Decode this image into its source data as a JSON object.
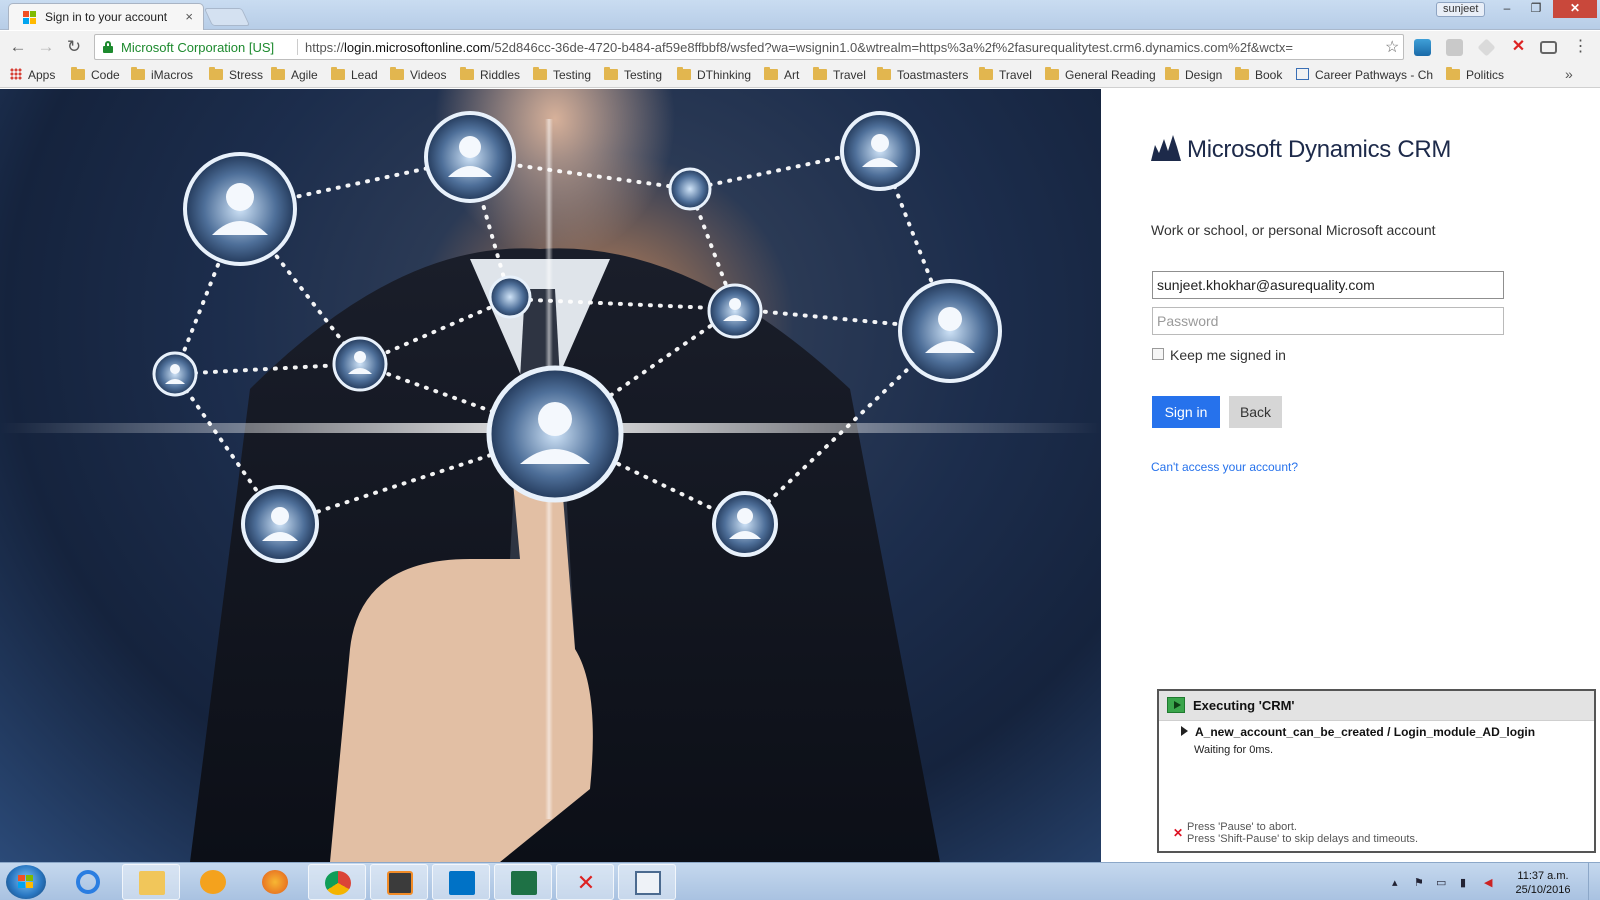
{
  "browser": {
    "tab_title": "Sign in to your account",
    "tab_close": "×",
    "profile_name": "sunjeet",
    "window_controls": {
      "minimize": "‒",
      "maximize": "❐",
      "close": "✕"
    },
    "nav": {
      "back": "←",
      "forward": "→",
      "reload": "↻"
    },
    "security_label": "Microsoft Corporation [US]",
    "url_prefix": "https://",
    "url_host": "login.microsoftonline.com",
    "url_path": "/52d846cc-36de-4720-b484-af59e8ffbbf8/wsfed?wa=wsignin1.0&wtrealm=https%3a%2f%2fasurequalitytest.crm6.dynamics.com%2f&wctx=",
    "star": "☆",
    "bookmarks_more": "»",
    "bookmarks": [
      {
        "label": "Apps",
        "icon": "apps-grid-icon"
      },
      {
        "label": "Code",
        "icon": "folder-icon"
      },
      {
        "label": "iMacros",
        "icon": "folder-icon"
      },
      {
        "label": "Stress",
        "icon": "folder-icon"
      },
      {
        "label": "Agile",
        "icon": "folder-icon"
      },
      {
        "label": "Lead",
        "icon": "folder-icon"
      },
      {
        "label": "Videos",
        "icon": "folder-icon"
      },
      {
        "label": "Riddles",
        "icon": "folder-icon"
      },
      {
        "label": "Testing",
        "icon": "folder-icon"
      },
      {
        "label": "Testing",
        "icon": "folder-icon"
      },
      {
        "label": "DThinking",
        "icon": "folder-icon"
      },
      {
        "label": "Art",
        "icon": "folder-icon"
      },
      {
        "label": "Travel",
        "icon": "folder-icon"
      },
      {
        "label": "Toastmasters",
        "icon": "folder-icon"
      },
      {
        "label": "Travel",
        "icon": "folder-icon"
      },
      {
        "label": "General Reading",
        "icon": "folder-icon"
      },
      {
        "label": "Design",
        "icon": "folder-icon"
      },
      {
        "label": "Book",
        "icon": "folder-icon"
      },
      {
        "label": "Career Pathways - Ch",
        "icon": "page-icon"
      },
      {
        "label": "Politics",
        "icon": "folder-icon"
      }
    ]
  },
  "login": {
    "brand": "Microsoft Dynamics CRM",
    "prompt": "Work or school, or personal Microsoft account",
    "email_value": "sunjeet.khokhar@asurequality.com",
    "password_placeholder": "Password",
    "keep_signed_in": "Keep me signed in",
    "sign_in": "Sign in",
    "back": "Back",
    "cant_access": "Can't access your account?"
  },
  "imacros": {
    "title": "Executing 'CRM'",
    "step": "A_new_account_can_be_created / Login_module_AD_login",
    "status": "Waiting for 0ms.",
    "hint_abort": "Press 'Pause' to abort.",
    "hint_skip": "Press 'Shift-Pause' to skip delays and timeouts."
  },
  "taskbar": {
    "time": "11:37 a.m.",
    "date": "25/10/2016",
    "items": [
      "ie-icon",
      "explorer-icon",
      "media-player-icon",
      "firefox-icon",
      "chrome-icon",
      "sublime-icon",
      "outlook-icon",
      "excel-icon",
      "tools-icon",
      "window-icon"
    ]
  },
  "colors": {
    "accent_blue": "#2672ec",
    "ev_green": "#1d8a2e",
    "brand_navy": "#1d2a4a"
  }
}
